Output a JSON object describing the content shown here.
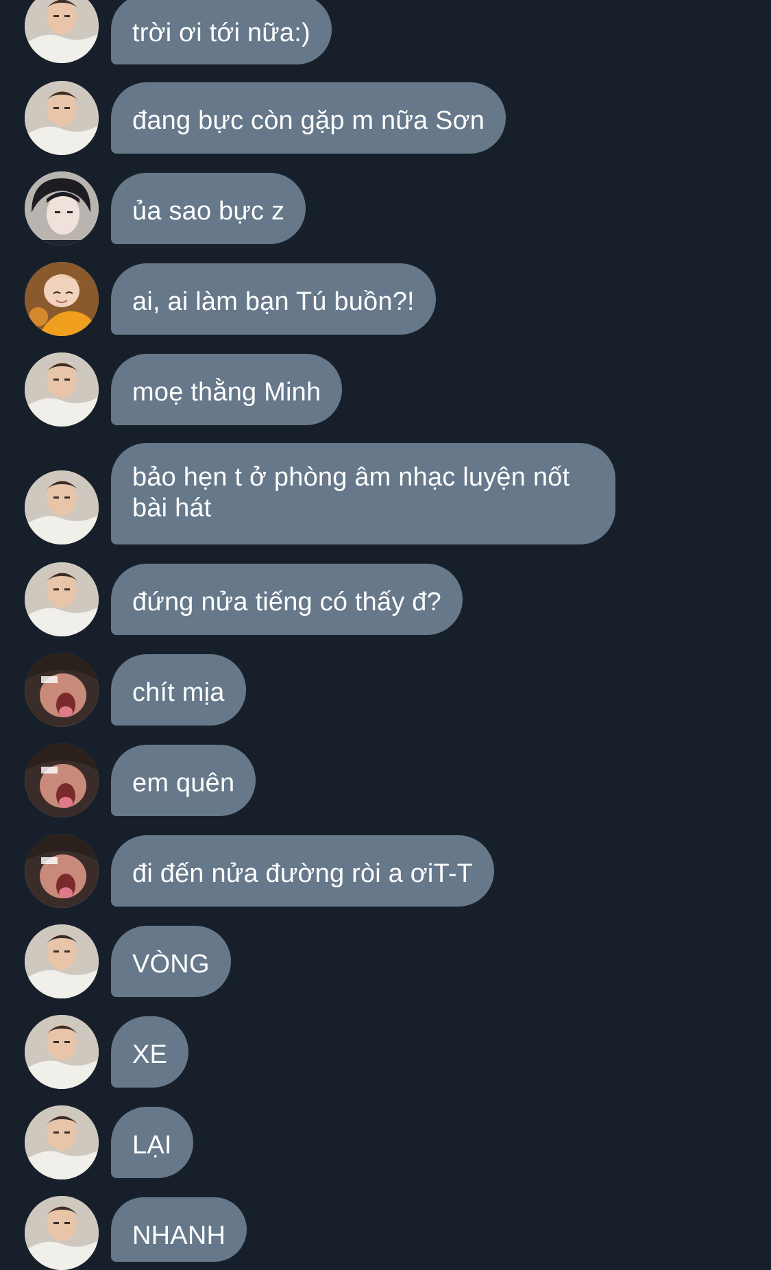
{
  "colors": {
    "background": "#17202a",
    "bubble": "#66788a",
    "text": "#ffffff"
  },
  "messages": [
    {
      "sender": "tu",
      "text": "trời ơi tới nữa:)"
    },
    {
      "sender": "tu",
      "text": "đang bực còn gặp m nữa Sơn"
    },
    {
      "sender": "son",
      "text": "ủa sao bực z"
    },
    {
      "sender": "yellow",
      "text": "ai, ai làm bạn Tú buồn?!"
    },
    {
      "sender": "tu",
      "text": "moẹ thằng Minh"
    },
    {
      "sender": "tu",
      "text": "bảo hẹn t ở phòng âm nhạc luyện nốt bài hát"
    },
    {
      "sender": "tu",
      "text": "đứng nửa tiếng có thấy đ?"
    },
    {
      "sender": "minh",
      "text": "chít mịa"
    },
    {
      "sender": "minh",
      "text": "em quên"
    },
    {
      "sender": "minh",
      "text": "đi đến nửa đường ròi a ơiT-T"
    },
    {
      "sender": "tu",
      "text": "VÒNG"
    },
    {
      "sender": "tu",
      "text": "XE"
    },
    {
      "sender": "tu",
      "text": "LẠI"
    },
    {
      "sender": "tu",
      "text": "NHANH"
    }
  ],
  "avatar_icons": {
    "tu": "sleepy-boy-avatar-icon",
    "son": "dark-hair-boy-avatar-icon",
    "yellow": "yellow-shirt-avatar-icon",
    "minh": "yelling-boy-avatar-icon"
  }
}
